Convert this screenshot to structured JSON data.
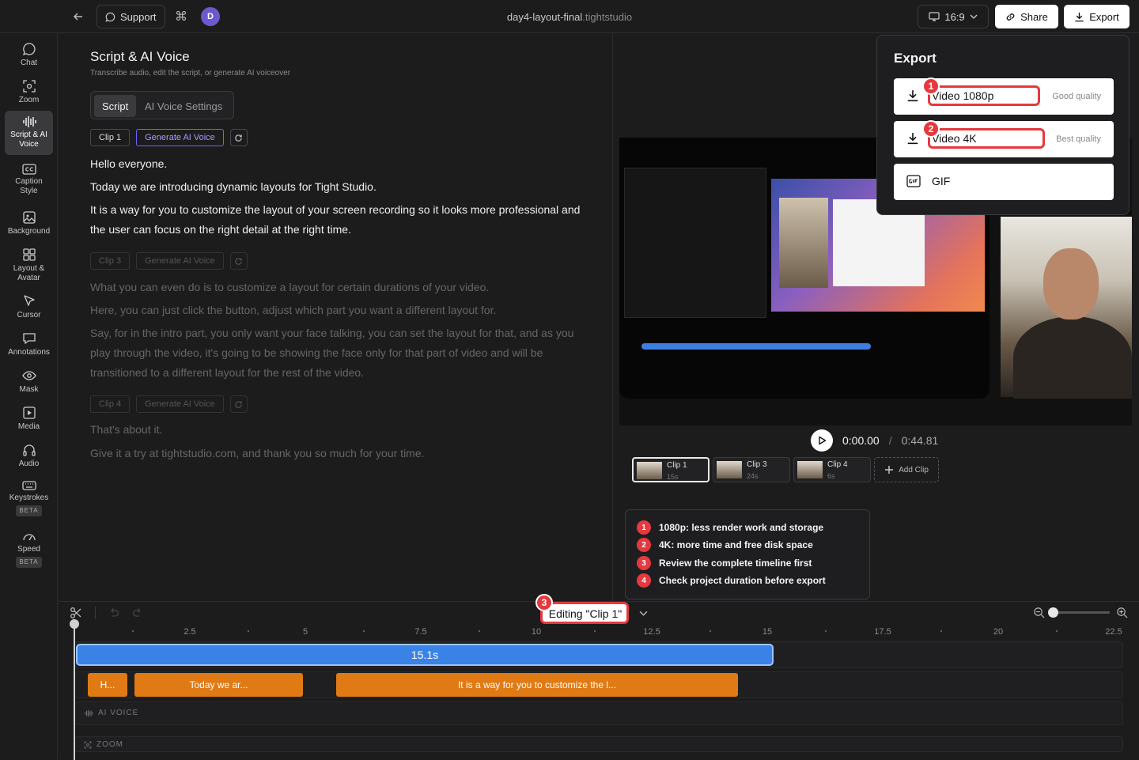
{
  "topbar": {
    "support_label": "Support",
    "avatar_initial": "D",
    "file_name": "day4-layout-final",
    "file_ext": ".tightstudio",
    "aspect_ratio": "16:9",
    "share_label": "Share",
    "export_label": "Export"
  },
  "sidebar": {
    "items": [
      {
        "label": "Chat",
        "icon": "chat-bubble-icon"
      },
      {
        "label": "Zoom",
        "icon": "zoom-focus-icon"
      },
      {
        "label": "Script & AI Voice",
        "icon": "waveform-icon",
        "active": true
      },
      {
        "label": "Caption Style",
        "icon": "cc-icon"
      },
      {
        "label": "Background",
        "icon": "image-icon"
      },
      {
        "label": "Layout & Avatar",
        "icon": "grid-icon"
      },
      {
        "label": "Cursor",
        "icon": "cursor-icon"
      },
      {
        "label": "Annotations",
        "icon": "speech-icon"
      },
      {
        "label": "Mask",
        "icon": "eye-icon"
      },
      {
        "label": "Media",
        "icon": "media-icon"
      },
      {
        "label": "Audio",
        "icon": "headphones-icon"
      },
      {
        "label": "Keystrokes",
        "icon": "keyboard-icon",
        "badge": "BETA"
      },
      {
        "label": "Speed",
        "icon": "gauge-icon",
        "badge": "BETA"
      }
    ]
  },
  "script": {
    "title": "Script & AI Voice",
    "subtitle": "Transcribe audio, edit the script, or generate AI voiceover",
    "tabs": [
      "Script",
      "AI Voice Settings"
    ],
    "generate_label": "Generate AI Voice",
    "clips": [
      {
        "name": "Clip 1",
        "paragraphs": [
          "Hello everyone.",
          "Today we are introducing dynamic layouts for Tight Studio.",
          "It is a way for you to customize the layout of your screen recording so it looks more professional and the user can focus on the right detail at the right time."
        ]
      },
      {
        "name": "Clip 3",
        "paragraphs": [
          "What you can even do is to customize a layout for certain durations of your video.",
          "Here, you can just click the button, adjust which part you want a different layout for.",
          "Say, for in the intro part, you only want your face talking, you can set the layout for that, and as you play through the video, it's going to be showing the face only for that part of video and will be transitioned to a different layout for the rest of the video."
        ]
      },
      {
        "name": "Clip 4",
        "paragraphs": [
          "That's about it.",
          "Give it a try at tightstudio.com, and thank you so much for your time."
        ]
      }
    ]
  },
  "export_panel": {
    "title": "Export",
    "options": [
      {
        "label": "Video 1080p",
        "quality": "Good quality",
        "icon": "download-icon"
      },
      {
        "label": "Video 4K",
        "quality": "Best quality",
        "icon": "download-icon"
      },
      {
        "label": "GIF",
        "quality": "",
        "icon": "gif-icon"
      }
    ]
  },
  "player": {
    "current_time": "0:00.00",
    "separator": "/",
    "total_time": "0:44.81"
  },
  "clip_strip": {
    "clips": [
      {
        "name": "Clip 1",
        "duration": "15s",
        "active": true
      },
      {
        "name": "Clip 3",
        "duration": "24s"
      },
      {
        "name": "Clip 4",
        "duration": "6s"
      }
    ],
    "add_label": "Add Clip"
  },
  "tips": [
    {
      "n": "1",
      "text": "1080p: less render work and storage"
    },
    {
      "n": "2",
      "text": "4K: more time and free disk space"
    },
    {
      "n": "3",
      "text": "Review the complete timeline first"
    },
    {
      "n": "4",
      "text": "Check project duration before export"
    }
  ],
  "callouts": [
    "1",
    "2",
    "3"
  ],
  "timeline": {
    "editing_label": "Editing \"Clip 1\"",
    "ticks": [
      "2.5",
      "5",
      "7.5",
      "10",
      "12.5",
      "15",
      "17.5",
      "20",
      "22.5"
    ],
    "main_clip_label": "15.1s",
    "subtitles": [
      "H...",
      "Today we ar...",
      "It is a way for you to customize the l..."
    ],
    "ai_voice_label": "AI VOICE",
    "zoom_label": "ZOOM"
  },
  "colors": {
    "accent_red": "#e5393f",
    "clip_blue": "#3b82e6",
    "subtitle_orange": "#e07a14",
    "generate_purple": "#6f63ff"
  }
}
